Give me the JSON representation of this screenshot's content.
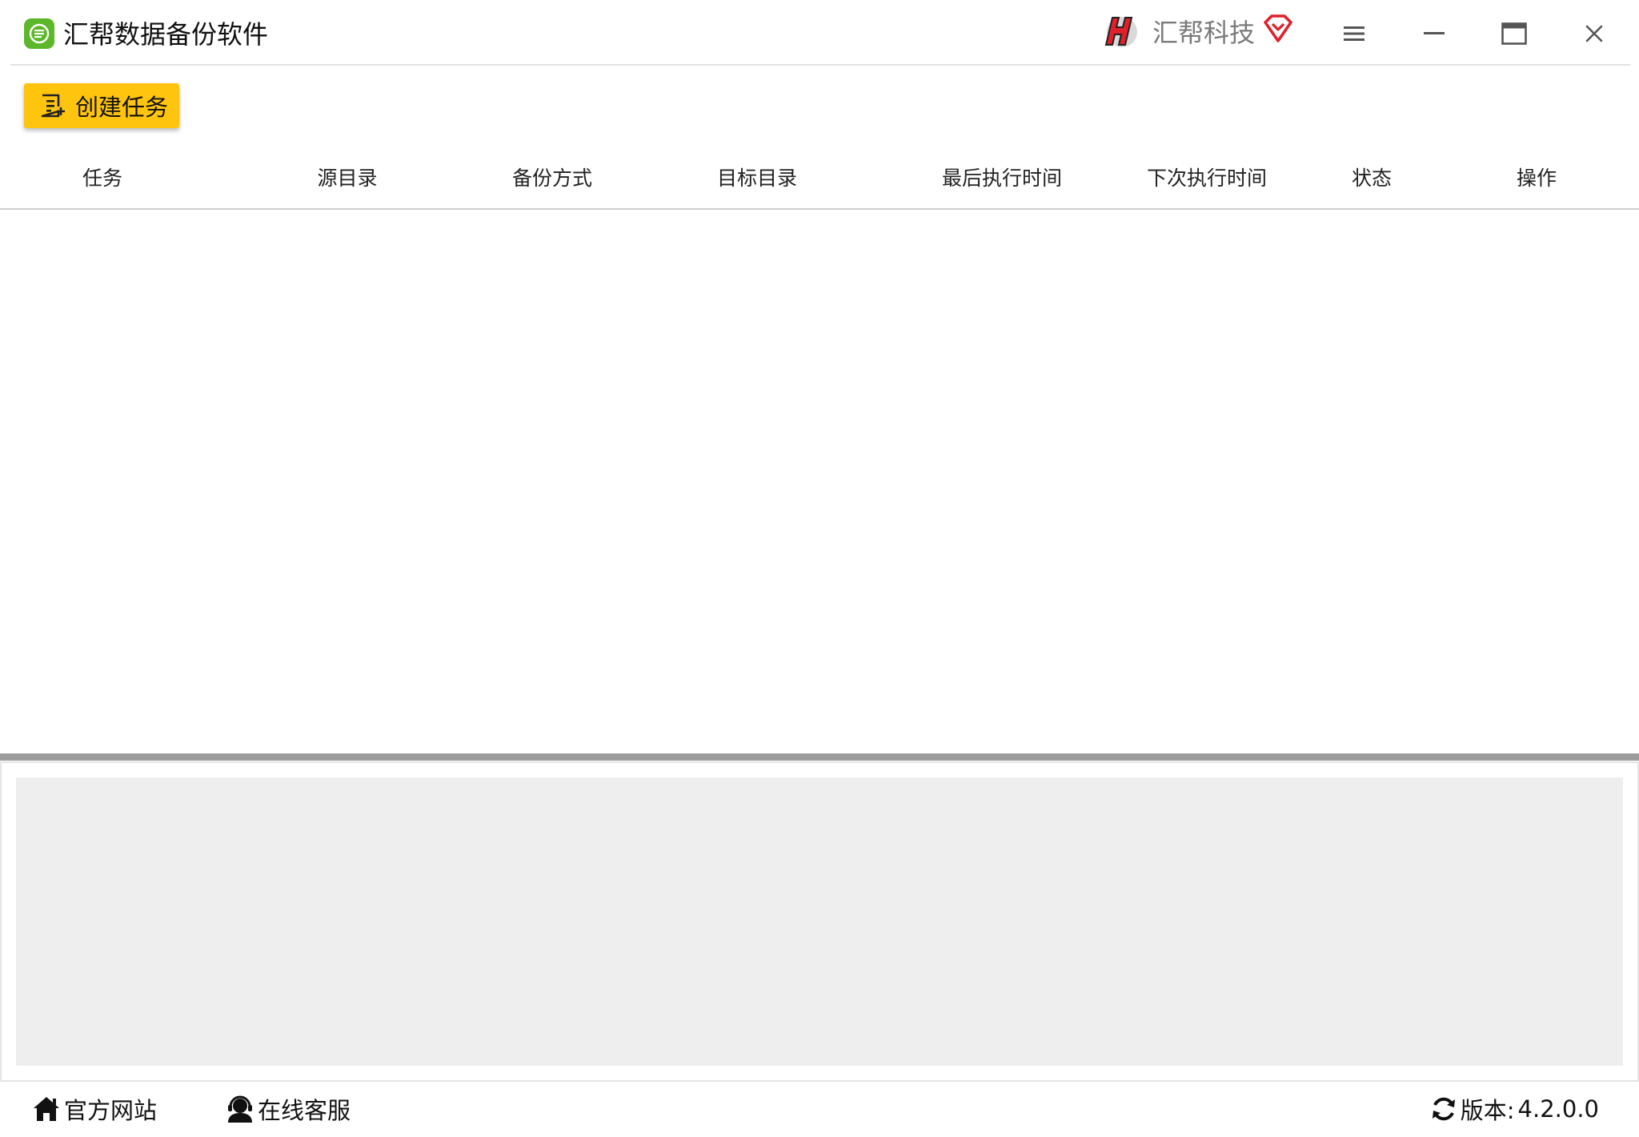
{
  "titlebar": {
    "app_title": "汇帮数据备份软件",
    "brand_name": "汇帮科技"
  },
  "toolbar": {
    "create_task_label": "创建任务"
  },
  "table": {
    "columns": [
      "任务",
      "源目录",
      "备份方式",
      "目标目录",
      "最后执行时间",
      "下次执行时间",
      "状态",
      "操作"
    ],
    "rows": []
  },
  "statusbar": {
    "official_site_label": "官方网站",
    "online_support_label": "在线客服",
    "version_label": "版本:",
    "version_value": "4.2.0.0"
  },
  "colors": {
    "accent_yellow": "#ffc40d",
    "app_logo_green": "#5cb82a",
    "brand_red": "#e0202a",
    "log_area_bg": "#eeeeee"
  },
  "icons": {
    "app_logo": "green-list-icon",
    "brand_logo": "huibang-logo-icon",
    "vip": "vip-diamond-icon",
    "menu": "hamburger-menu-icon",
    "minimize": "minimize-icon",
    "maximize": "maximize-icon",
    "close": "close-icon",
    "create_task": "task-list-add-icon",
    "official_site": "home-icon",
    "online_support": "customer-service-icon",
    "version": "refresh-icon"
  }
}
